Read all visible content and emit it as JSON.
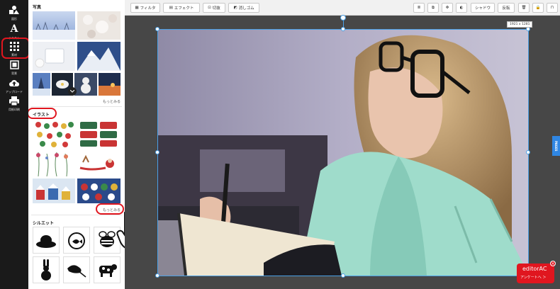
{
  "rail": {
    "items": [
      {
        "label": "図形",
        "icon": "shapes-icon"
      },
      {
        "label": "テキスト",
        "icon": "text-icon"
      },
      {
        "label": "素材",
        "icon": "grid-icon"
      },
      {
        "label": "背景",
        "icon": "background-icon"
      },
      {
        "label": "アップロード",
        "icon": "upload-icon"
      },
      {
        "label": "用紙印刷",
        "icon": "print-icon"
      }
    ]
  },
  "panel": {
    "photos_title": "写真",
    "photos_more": "もっとみる",
    "illust_title": "イラスト",
    "illust_more": "もっとみる",
    "silhouette_title": "シルエット"
  },
  "toolbar": {
    "filter": "フィルタ",
    "effect": "エフェクト",
    "crop": "切抜",
    "eraser": "消しゴム",
    "shadow": "シャドウ",
    "flip": "反転"
  },
  "canvas": {
    "size_badge": "1921 x 1281",
    "pages_tab": "PAGES"
  },
  "survey": {
    "brand": "editorAC",
    "cta": "アンケートへ ＞"
  },
  "colors": {
    "accent_red": "#e0161f",
    "selection_blue": "#4aa0e6",
    "rail_bg": "#1a1a1a"
  }
}
